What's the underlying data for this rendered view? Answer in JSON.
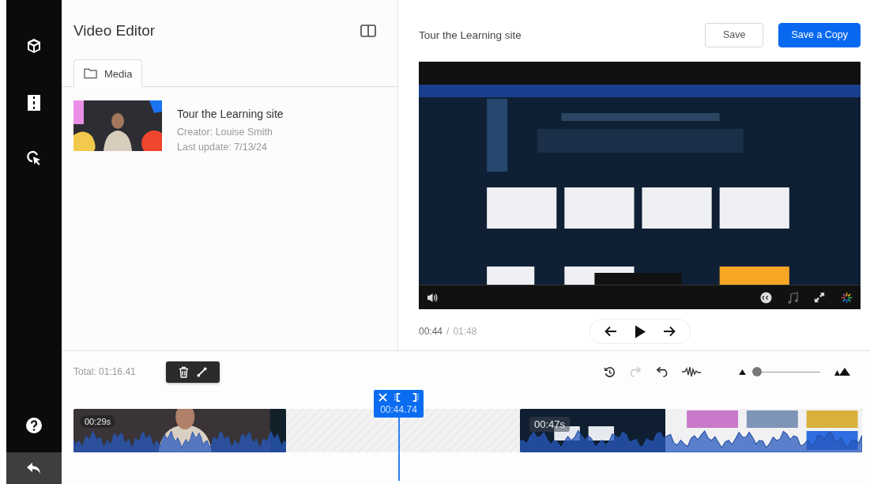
{
  "editor": {
    "title": "Video Editor",
    "tabs": [
      {
        "label": "Media",
        "selected": true
      }
    ],
    "media": [
      {
        "title": "Tour the Learning site",
        "creator": "Creator: Louise Smith",
        "updated": "Last update: 7/13/24"
      }
    ]
  },
  "preview": {
    "title": "Tour the Learning site",
    "buttons": [
      {
        "label": "Save",
        "kind": "secondary"
      },
      {
        "label": "Save a Copy",
        "kind": "primary"
      }
    ],
    "current_time": "00:44",
    "separator": "/",
    "duration": "01:48"
  },
  "timeline": {
    "total": "Total: 01:16.41",
    "tools": [
      {
        "kind": "reset",
        "disabled": false
      },
      {
        "kind": "redo",
        "disabled": true
      },
      {
        "kind": "undo",
        "disabled": false
      },
      {
        "kind": "audio",
        "disabled": false
      }
    ],
    "zoom": {
      "level": 0.05
    },
    "playhead": {
      "time": "00:44.74"
    },
    "clips": [
      {
        "kind": "clip",
        "duration": "00:29s"
      },
      {
        "kind": "gap"
      },
      {
        "kind": "clip",
        "duration": "00:47s"
      }
    ]
  }
}
